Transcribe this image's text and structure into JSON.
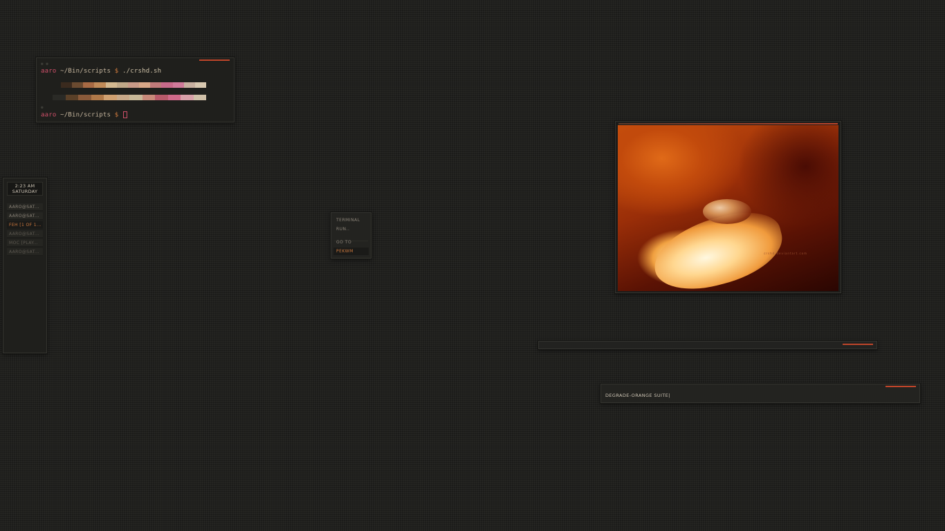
{
  "terminal": {
    "user": "aaro",
    "path": "~/Bin/scripts",
    "prompt": "$",
    "command": "./crshd.sh",
    "line2_user": "aaro",
    "line2_path": "~/Bin/scripts",
    "line2_prompt": "$",
    "palette_top": [
      "#3a2a1e",
      "#6a4a30",
      "#a86a44",
      "#c08a58",
      "#d4b890",
      "#c0a888",
      "#c89a88",
      "#d8a888",
      "#c07a7a",
      "#c86a8a",
      "#d07a9a",
      "#c8b0a0",
      "#d8c8b0"
    ],
    "palette_bottom": [
      "#2a2a26",
      "#5a4028",
      "#8a5a3a",
      "#b07848",
      "#d0a070",
      "#c8a888",
      "#c8b898",
      "#c88a7a",
      "#b85a6a",
      "#d06a8a",
      "#d8a0a8",
      "#d0c0a8"
    ]
  },
  "panel": {
    "clock_time": "2:23 AM",
    "clock_day": "SATURDAY",
    "tasks": [
      {
        "label": "AARO@SAT..."
      },
      {
        "label": "AARO@SAT..."
      },
      {
        "label": "FEH [1 OF 1..."
      },
      {
        "label": "AARO@SAT..."
      },
      {
        "label": "MOC [PLAY..."
      },
      {
        "label": "AARO@SAT..."
      }
    ]
  },
  "menu": {
    "items": [
      "TERMINAL",
      "RUN..",
      "GO TO",
      "PEKWM"
    ]
  },
  "viewer": {
    "watermark": "crshd.deviantart.com"
  },
  "input": {
    "text": "DEGRADE-ORANGE SUITE|"
  },
  "colors": {
    "accent": "#c0452a",
    "background": "#1c1c1a",
    "window": "#232320",
    "text": "#cfc6b6",
    "highlight": "#d07b3e"
  }
}
